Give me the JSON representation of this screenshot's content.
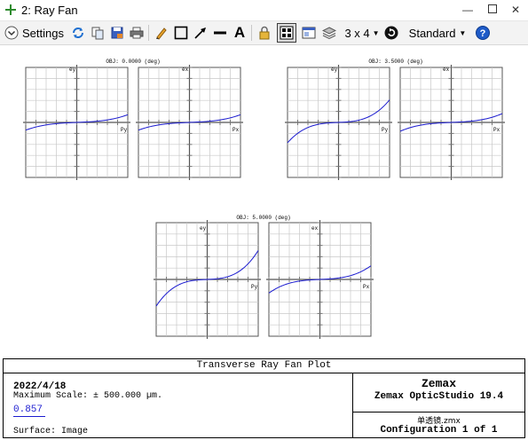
{
  "window": {
    "title": "2: Ray Fan"
  },
  "toolbar": {
    "settings_label": "Settings",
    "layout_label": "3 x 4",
    "standard_label": "Standard",
    "icons": [
      "chevron-down-icon",
      "refresh-icon",
      "copy-icon",
      "save-icon",
      "print-icon",
      "pencil-icon",
      "rectangle-icon",
      "arrow-icon",
      "line-icon",
      "text-icon",
      "lock-icon",
      "grid-icon",
      "window-icon",
      "layers-icon",
      "rotate-icon",
      "help-icon"
    ]
  },
  "plots": [
    {
      "obj_label": "OBJ: 0.0000 (deg)",
      "left_ylabel": "ey",
      "left_xlabel": "Py",
      "right_ylabel": "ex",
      "right_xlabel": "Px"
    },
    {
      "obj_label": "OBJ: 3.5000 (deg)",
      "left_ylabel": "ey",
      "left_xlabel": "Py",
      "right_ylabel": "ex",
      "right_xlabel": "Px"
    },
    {
      "obj_label": "OBJ: 5.0000 (deg)",
      "left_ylabel": "ey",
      "left_xlabel": "Py",
      "right_ylabel": "ex",
      "right_xlabel": "Px"
    }
  ],
  "footer": {
    "title": "Transverse Ray Fan Plot",
    "date": "2022/4/18",
    "max_scale": "Maximum Scale: ± 500.000 µm.",
    "wavelength": "0.857",
    "surface": "Surface: Image",
    "company": "Zemax",
    "product": "Zemax OpticStudio 19.4",
    "file": "单透镜.zmx",
    "config": "Configuration 1 of 1"
  },
  "colors": {
    "curve": "#1c1cd0",
    "grid": "#c8c8c8",
    "wavelength_text": "#1c1cd0"
  }
}
